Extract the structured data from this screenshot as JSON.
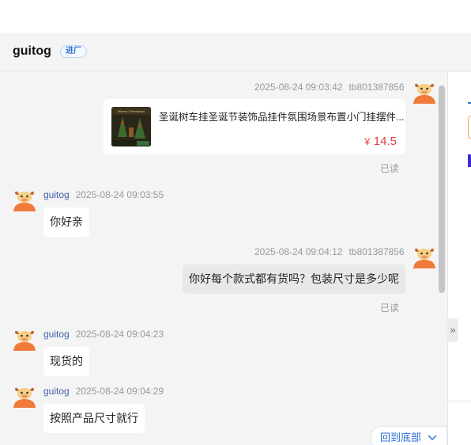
{
  "header": {
    "name": "guitog",
    "badge": "进厂"
  },
  "messages": [
    {
      "side": "right",
      "time": "2025-08-24 09:03:42",
      "sender": "tb801387856",
      "product": {
        "title": "圣诞树车挂圣诞节装饰品挂件氛围场景布置小门挂摆件...",
        "price_symbol": "￥",
        "price": "14.5",
        "thumb_text": "Merry Christmas"
      },
      "read": "已读"
    },
    {
      "side": "left",
      "nick": "guitog",
      "time": "2025-08-24 09:03:55",
      "text": "你好亲"
    },
    {
      "side": "right",
      "time": "2025-08-24 09:04:12",
      "sender": "tb801387856",
      "text": "你好每个款式都有货吗？包装尺寸是多少呢",
      "read": "已读"
    },
    {
      "side": "left",
      "nick": "guitog",
      "time": "2025-08-24 09:04:23",
      "text": "现货的"
    },
    {
      "side": "left",
      "nick": "guitog",
      "time": "2025-08-24 09:04:29",
      "text": "按照产品尺寸就行"
    }
  ],
  "back_to_bottom": "回到底部",
  "colors": {
    "accent": "#2f6fd6",
    "price": "#e4393c",
    "avatar": "#f07a3a"
  },
  "icons": {
    "avatar": "cow-avatar-icon",
    "collapse": "double-chevron-right-icon",
    "back_to_bottom": "chevron-down-icon"
  }
}
